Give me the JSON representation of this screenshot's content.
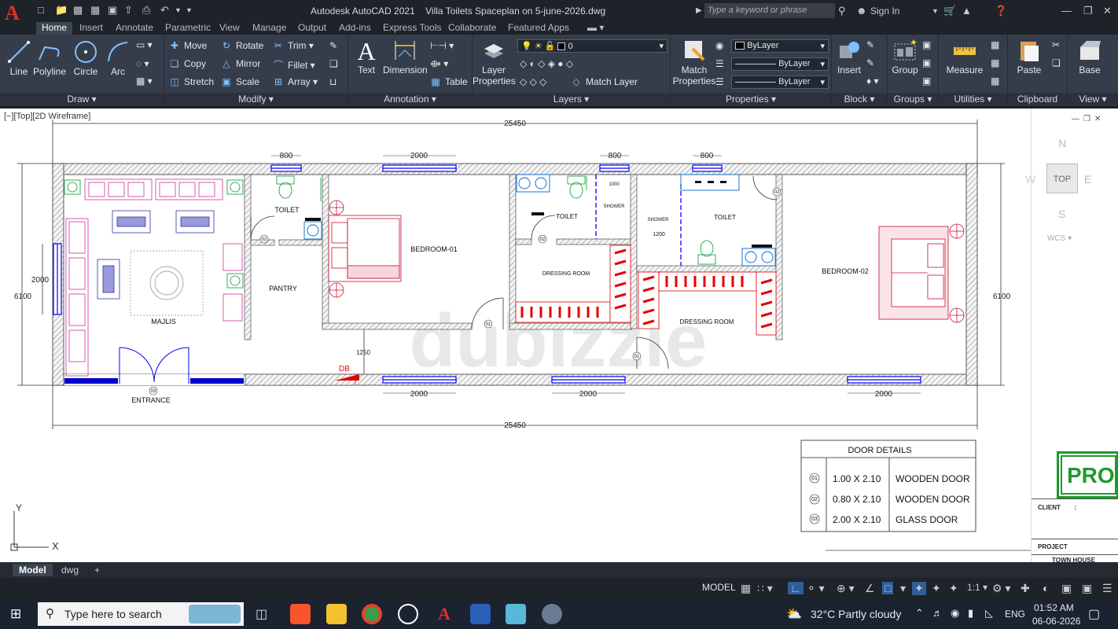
{
  "title_bar": {
    "app_name": "Autodesk AutoCAD 2021",
    "file_name": "Villa Toilets Spaceplan on 5-june-2026.dwg",
    "search_placeholder": "Type a keyword or phrase",
    "sign_in": "Sign In"
  },
  "ribbon_tabs": [
    "Home",
    "Insert",
    "Annotate",
    "Parametric",
    "View",
    "Manage",
    "Output",
    "Add-ins",
    "Express Tools",
    "Collaborate",
    "Featured Apps"
  ],
  "ribbon": {
    "draw": {
      "title": "Draw",
      "line": "Line",
      "polyline": "Polyline",
      "circle": "Circle",
      "arc": "Arc"
    },
    "modify": {
      "title": "Modify",
      "move": "Move",
      "rotate": "Rotate",
      "trim": "Trim",
      "copy": "Copy",
      "mirror": "Mirror",
      "fillet": "Fillet",
      "stretch": "Stretch",
      "scale": "Scale",
      "array": "Array"
    },
    "annotation": {
      "title": "Annotation",
      "text": "Text",
      "dimension": "Dimension",
      "table": "Table"
    },
    "layers": {
      "title": "Layers",
      "layer_properties": "Layer Properties",
      "current_layer": "0",
      "match_layer": "Match Layer"
    },
    "properties": {
      "title": "Properties",
      "match_properties": "Match Properties",
      "color": "ByLayer",
      "linetype": "ByLayer",
      "lineweight": "ByLayer"
    },
    "block": {
      "title": "Block",
      "insert": "Insert"
    },
    "groups": {
      "title": "Groups",
      "group": "Group"
    },
    "utilities": {
      "title": "Utilities",
      "measure": "Measure"
    },
    "clipboard": {
      "title": "Clipboard",
      "paste": "Paste"
    },
    "view": {
      "title": "View",
      "base": "Base"
    }
  },
  "viewport_label": "[−][Top][2D Wireframe]",
  "viewcube": {
    "north": "N",
    "south": "S",
    "east": "E",
    "west": "W",
    "top": "TOP",
    "wcs": "WCS"
  },
  "drawing": {
    "dims": {
      "overall_top": "25450",
      "overall_bottom": "25450",
      "height_left": "6100",
      "height_right": "6100",
      "window_left": "2000",
      "pantry_gap": "1250",
      "shower_a": "1000",
      "shower_b": "1200"
    },
    "top_windows": [
      "800",
      "2000",
      "800",
      "800"
    ],
    "bottom_windows": [
      "2000",
      "2000",
      "2000"
    ],
    "rooms": {
      "majlis": "MAJLIS",
      "pantry": "PANTRY",
      "toilet1": "TOILET",
      "bedroom1": "BEDROOM-01",
      "toilet2": "TOILET",
      "shower1": "SHOWER",
      "dressing1": "DRESSING ROOM",
      "shower2": "SHOWER",
      "toilet3": "TOILET",
      "dressing2": "DRESSING ROOM",
      "bedroom2": "BEDROOM-02",
      "entrance": "ENTRANCE",
      "db": "DB"
    },
    "door_tags": [
      "01",
      "02",
      "03"
    ],
    "watermark": "dubizzle"
  },
  "door_details": {
    "title": "DOOR DETAILS",
    "rows": [
      {
        "tag": "01",
        "size": "1.00 X 2.10",
        "type": "WOODEN DOOR"
      },
      {
        "tag": "02",
        "size": "0.80 X 2.10",
        "type": "WOODEN DOOR"
      },
      {
        "tag": "03",
        "size": "2.00 X 2.10",
        "type": "GLASS DOOR"
      }
    ]
  },
  "title_block": {
    "stamp": "PROF",
    "client": "CLIENT",
    "project": "PROJECT",
    "project_name": "TOWN HOUSE"
  },
  "ucs": {
    "y": "Y",
    "x": "X"
  },
  "layout_tabs": [
    "Model",
    "dwg"
  ],
  "status_bar": {
    "model": "MODEL",
    "scale": "1:1"
  },
  "taskbar": {
    "search_placeholder": "Type here to search",
    "weather": "32°C  Partly cloudy",
    "language": "ENG",
    "time": "01:52 AM",
    "date": "06-06-2026"
  },
  "colors": {
    "wall": "#555555",
    "door": "#0000ff",
    "furniture": "#cc3399",
    "sanitary": "#009933",
    "wardrobe": "#e60000",
    "bed": "#c8102e"
  }
}
